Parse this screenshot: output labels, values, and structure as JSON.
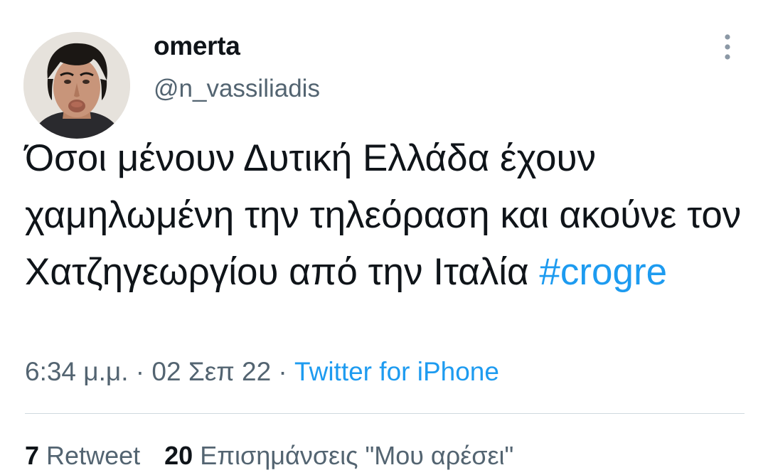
{
  "user": {
    "display_name": "omerta",
    "handle": "@n_vassiliadis",
    "avatar_icon": "avatar-photo"
  },
  "tweet": {
    "text_parts": [
      "Όσοι μένουν Δυτική Ελλάδα έχουν χαμηλωμένη την τηλεόραση και ακούνε τον Χατζηγεωργίου από την Ιταλία "
    ],
    "hashtag": "#crogre"
  },
  "meta": {
    "time": "6:34 μ.μ.",
    "sep1": " · ",
    "date": "02 Σεπ 22",
    "sep2": " · ",
    "source": "Twitter for iPhone"
  },
  "stats": {
    "retweets_count": "7",
    "retweets_label": "Retweet",
    "likes_count": "20",
    "likes_label": "Επισημάνσεις \"Μου αρέσει\""
  },
  "colors": {
    "link": "#1d9bf0",
    "secondary_text": "#536471",
    "primary_text": "#0f1419",
    "divider": "#cfd9de"
  },
  "icons": {
    "more": "more-vertical-icon"
  }
}
